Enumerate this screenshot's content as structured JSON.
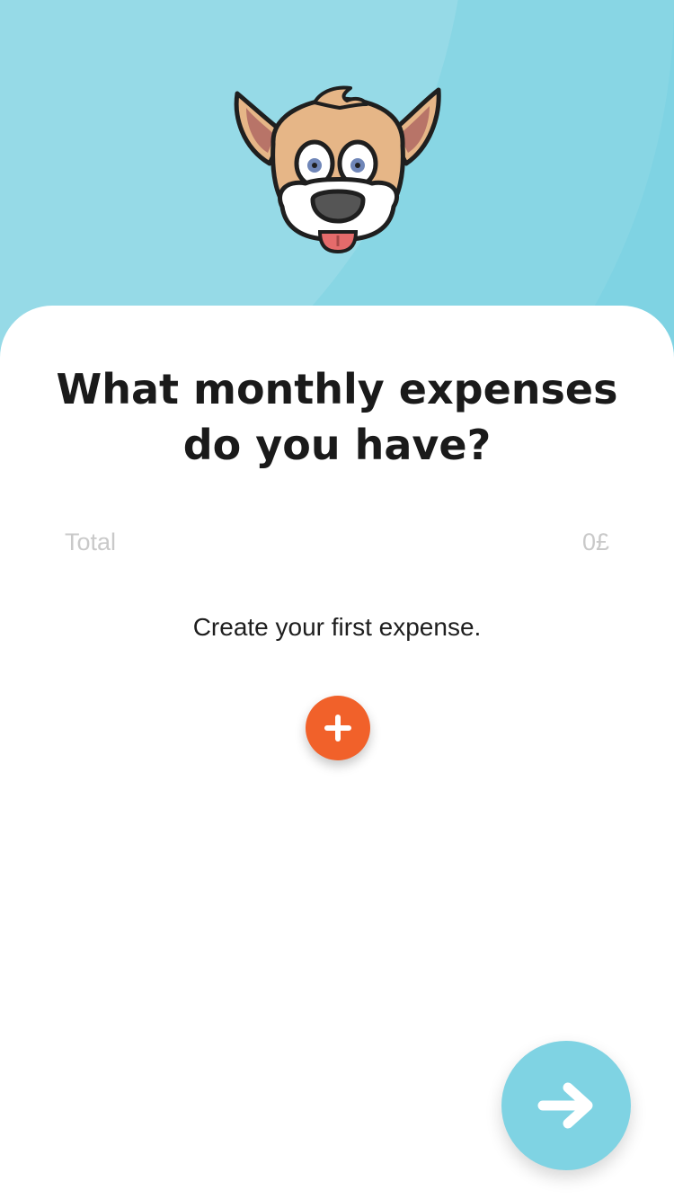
{
  "colors": {
    "hero_background": "#7fd3e3",
    "accent_orange": "#f1612a",
    "next_button": "#7fd3e3",
    "title_text": "#1a1a1a",
    "muted_text": "#c9c9c9"
  },
  "header": {
    "mascot": "dog-mascot-illustration"
  },
  "main": {
    "title": "What monthly expenses do you have?",
    "total": {
      "label": "Total",
      "amount": "0£"
    },
    "empty_message": "Create your first expense.",
    "add_button_icon": "plus-icon"
  },
  "footer": {
    "next_button_icon": "arrow-right-icon"
  }
}
